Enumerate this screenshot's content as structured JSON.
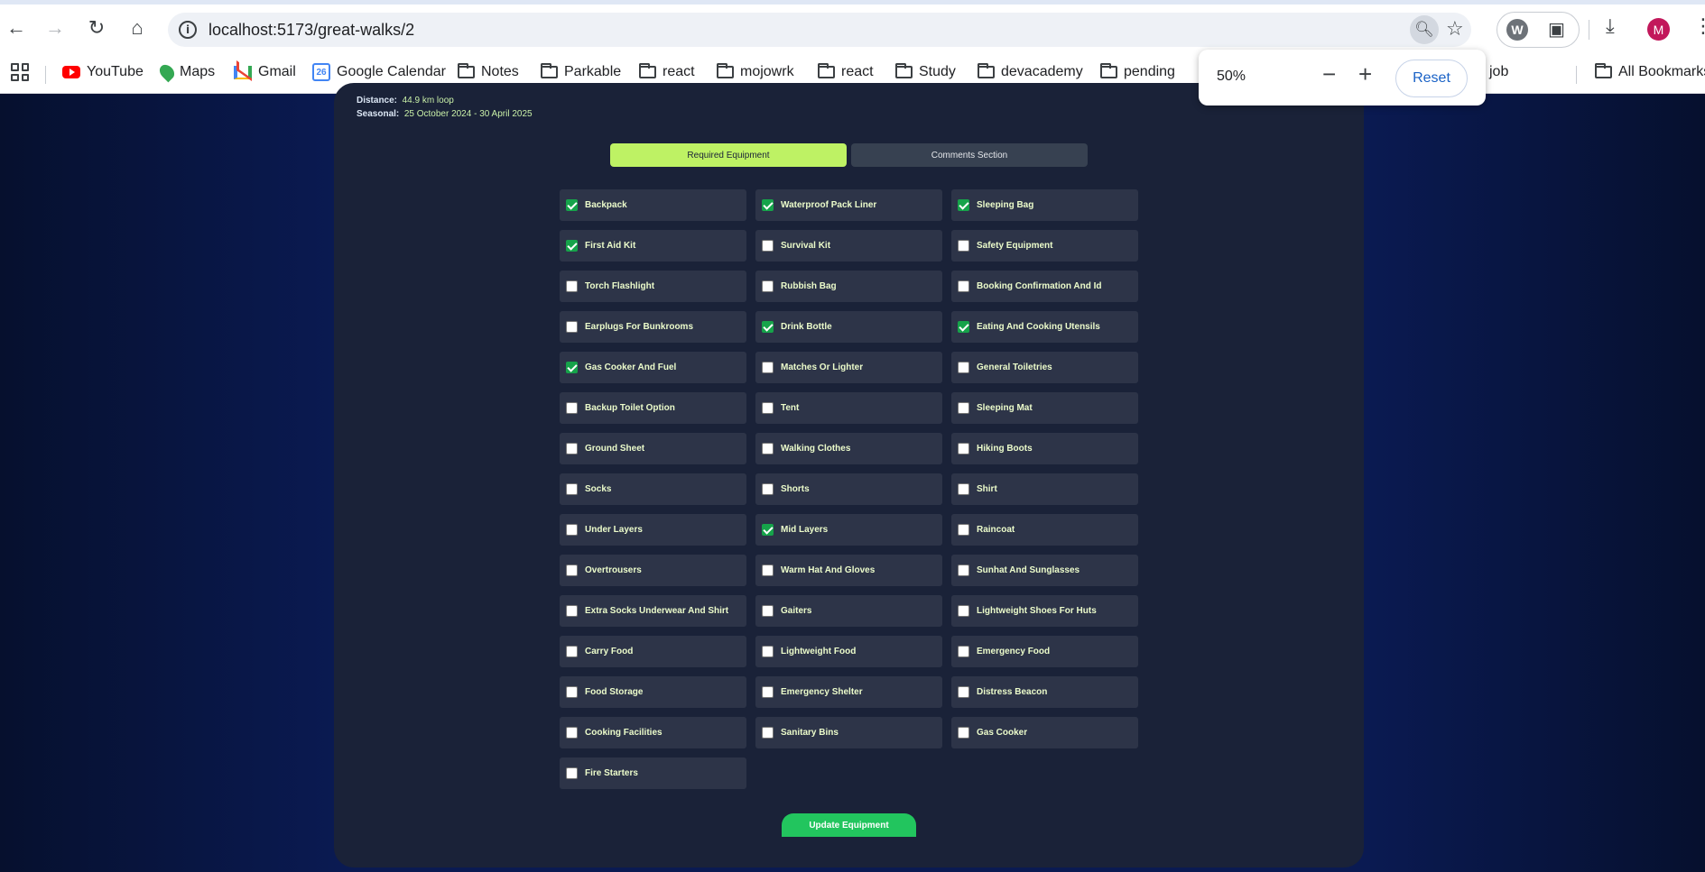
{
  "browser": {
    "url": "localhost:5173/great-walks/2",
    "bookmarks": [
      {
        "label": "YouTube",
        "icon": "youtube-icon"
      },
      {
        "label": "Maps",
        "icon": "maps-icon"
      },
      {
        "label": "Gmail",
        "icon": "gmail-icon"
      },
      {
        "label": "Google Calendar",
        "icon": "calendar-icon"
      },
      {
        "label": "Notes",
        "icon": "folder-icon"
      },
      {
        "label": "Parkable",
        "icon": "folder-icon"
      },
      {
        "label": "react",
        "icon": "folder-icon"
      },
      {
        "label": "mojowrk",
        "icon": "folder-icon"
      },
      {
        "label": "react",
        "icon": "folder-icon"
      },
      {
        "label": "Study",
        "icon": "folder-icon"
      },
      {
        "label": "devacademy",
        "icon": "folder-icon"
      },
      {
        "label": "pending",
        "icon": "folder-icon"
      }
    ],
    "bookmark_job": "job",
    "all_bookmarks": "All Bookmarks",
    "avatar_letter": "M",
    "calendar_day": "26",
    "zoom": {
      "value": "50%",
      "reset_label": "Reset"
    }
  },
  "walk": {
    "distance_label": "Distance:",
    "distance_value": "44.9 km loop",
    "seasonal_label": "Seasonal:",
    "seasonal_value": "25 October 2024 - 30 April 2025"
  },
  "tabs": {
    "required": "Required Equipment",
    "comments": "Comments Section"
  },
  "equipment": [
    {
      "label": "Backpack",
      "checked": true
    },
    {
      "label": "Waterproof Pack Liner",
      "checked": true
    },
    {
      "label": "Sleeping Bag",
      "checked": true
    },
    {
      "label": "First Aid Kit",
      "checked": true
    },
    {
      "label": "Survival Kit",
      "checked": false
    },
    {
      "label": "Safety Equipment",
      "checked": false
    },
    {
      "label": "Torch Flashlight",
      "checked": false
    },
    {
      "label": "Rubbish Bag",
      "checked": false
    },
    {
      "label": "Booking Confirmation And Id",
      "checked": false
    },
    {
      "label": "Earplugs For Bunkrooms",
      "checked": false
    },
    {
      "label": "Drink Bottle",
      "checked": true
    },
    {
      "label": "Eating And Cooking Utensils",
      "checked": true
    },
    {
      "label": "Gas Cooker And Fuel",
      "checked": true
    },
    {
      "label": "Matches Or Lighter",
      "checked": false
    },
    {
      "label": "General Toiletries",
      "checked": false
    },
    {
      "label": "Backup Toilet Option",
      "checked": false
    },
    {
      "label": "Tent",
      "checked": false
    },
    {
      "label": "Sleeping Mat",
      "checked": false
    },
    {
      "label": "Ground Sheet",
      "checked": false
    },
    {
      "label": "Walking Clothes",
      "checked": false
    },
    {
      "label": "Hiking Boots",
      "checked": false
    },
    {
      "label": "Socks",
      "checked": false
    },
    {
      "label": "Shorts",
      "checked": false
    },
    {
      "label": "Shirt",
      "checked": false
    },
    {
      "label": "Under Layers",
      "checked": false
    },
    {
      "label": "Mid Layers",
      "checked": true
    },
    {
      "label": "Raincoat",
      "checked": false
    },
    {
      "label": "Overtrousers",
      "checked": false
    },
    {
      "label": "Warm Hat And Gloves",
      "checked": false
    },
    {
      "label": "Sunhat And Sunglasses",
      "checked": false
    },
    {
      "label": "Extra Socks Underwear And Shirt",
      "checked": false
    },
    {
      "label": "Gaiters",
      "checked": false
    },
    {
      "label": "Lightweight Shoes For Huts",
      "checked": false
    },
    {
      "label": "Carry Food",
      "checked": false
    },
    {
      "label": "Lightweight Food",
      "checked": false
    },
    {
      "label": "Emergency Food",
      "checked": false
    },
    {
      "label": "Food Storage",
      "checked": false
    },
    {
      "label": "Emergency Shelter",
      "checked": false
    },
    {
      "label": "Distress Beacon",
      "checked": false
    },
    {
      "label": "Cooking Facilities",
      "checked": false
    },
    {
      "label": "Sanitary Bins",
      "checked": false
    },
    {
      "label": "Gas Cooker",
      "checked": false
    },
    {
      "label": "Fire Starters",
      "checked": false
    }
  ],
  "update_button": "Update Equipment"
}
